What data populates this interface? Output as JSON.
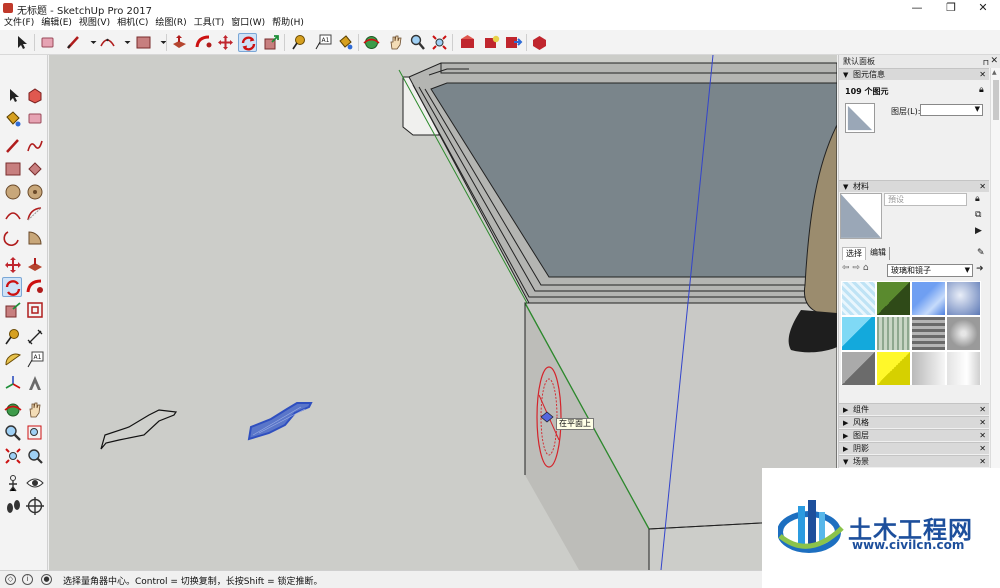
{
  "window": {
    "title": "无标题 - SketchUp Pro 2017",
    "minimize": "—",
    "maximize": "❐",
    "close": "✕"
  },
  "menu": [
    "文件(F)",
    "编辑(E)",
    "视图(V)",
    "相机(C)",
    "绘图(R)",
    "工具(T)",
    "窗口(W)",
    "帮助(H)"
  ],
  "viewport": {
    "inference_tooltip": "在平面上",
    "colors": {
      "background": "#cccdc9",
      "box_top": "#7a858b",
      "box_side": "#c9c9c6",
      "box_front": "#bdbdb9",
      "blue_axis": "#3344cc",
      "green_axis": "#2c8a2c",
      "protractor": "#d4232a",
      "selected": "#2f4fbf"
    }
  },
  "panel": {
    "title": "默认面板",
    "pin_icon": "pin-icon",
    "close": "✕",
    "entity_info": {
      "header": "图元信息",
      "count": "109 个图元",
      "layer_label": "图层(L):",
      "layer_value": ""
    },
    "materials": {
      "header": "材料",
      "name_placeholder": "預设",
      "tab_select": "选择",
      "tab_edit": "编辑",
      "library": "玻璃和镜子"
    },
    "collapsed_trays": [
      "组件",
      "风格",
      "图层",
      "阴影",
      "场景"
    ]
  },
  "status": {
    "text": "选择量角器中心。Control = 切换复制，长按Shift = 锁定推断。"
  },
  "watermark": {
    "title": "土木工程网",
    "url": "www.civilcn.com"
  }
}
